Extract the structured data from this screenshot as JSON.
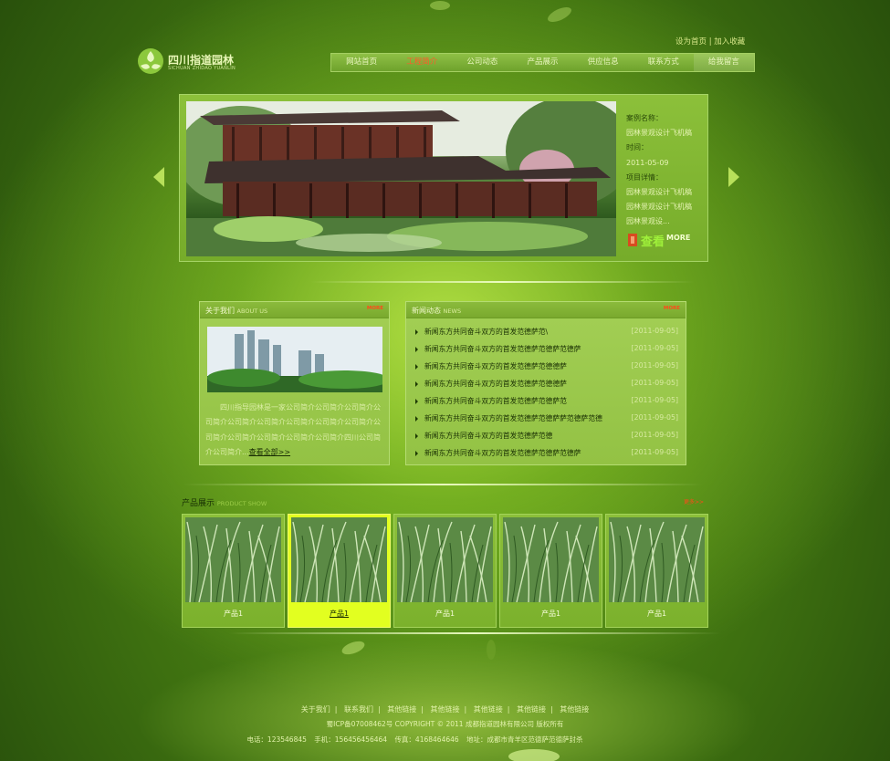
{
  "header": {
    "top_links": [
      "设为首页",
      "加入收藏"
    ],
    "top_sep": "|",
    "logo_cn": "四川指道园林",
    "logo_en": "SICHUAN ZHIDAO YUANLIN"
  },
  "nav": {
    "items": [
      "网站首页",
      "工程简介",
      "公司动态",
      "产品展示",
      "供应信息",
      "联系方式",
      "给我留言"
    ],
    "active_index": 1
  },
  "banner": {
    "case_label": "案例名称：",
    "case_value": "园林景观设计飞机稿",
    "time_label": "时间：",
    "time_value": "2011-05-09",
    "detail_label": "项目详情：",
    "detail_lines": [
      "园林景观设计飞机稿",
      "园林景观设计飞机稿",
      "园林景观设..."
    ],
    "more_cn": "查看",
    "more_en": "MORE"
  },
  "about": {
    "title": "关于我们",
    "title_en": "ABOUT US",
    "more": "MORE",
    "text": "四川指导园林是一家公司简介公司简介公司简介公司简介公司简介公司简介公司简介公司简介公司简介公司简介公司简介公司简介公司简介公司简介四川公司简介公司简介...",
    "read_more": "查看全部>>"
  },
  "news": {
    "title": "新闻动态",
    "title_en": "NEWS",
    "more": "MORE",
    "items": [
      {
        "title": "新闻东方共同奋斗双方的首发范德萨范\\",
        "date": "[2011-09-05]"
      },
      {
        "title": "新闻东方共同奋斗双方的首发范德萨范德萨范德萨",
        "date": "[2011-09-05]"
      },
      {
        "title": "新闻东方共同奋斗双方的首发范德萨范德德萨",
        "date": "[2011-09-05]"
      },
      {
        "title": "新闻东方共同奋斗双方的首发范德萨范德德萨",
        "date": "[2011-09-05]"
      },
      {
        "title": "新闻东方共同奋斗双方的首发范德萨范德萨范",
        "date": "[2011-09-05]"
      },
      {
        "title": "新闻东方共同奋斗双方的首发范德萨范德萨萨范德萨范德",
        "date": "[2011-09-05]"
      },
      {
        "title": "新闻东方共同奋斗双方的首发范德萨范德",
        "date": "[2011-09-05]"
      },
      {
        "title": "新闻东方共同奋斗双方的首发范德萨范德萨范德萨",
        "date": "[2011-09-05]"
      }
    ]
  },
  "products": {
    "title": "产品展示",
    "title_en": "PRODUCT SHOW",
    "more": "更多>>",
    "items": [
      "产品1",
      "产品1",
      "产品1",
      "产品1",
      "产品1"
    ],
    "selected_index": 1
  },
  "footer": {
    "links": [
      "关于我们",
      "联系我们",
      "其他链接",
      "其他链接",
      "其他链接",
      "其他链接",
      "其他链接"
    ],
    "link_sep": "|",
    "copyright": "蜀ICP备07008462号 COPYRIGHT © 2011 成都指道园林有限公司 版权所有",
    "phone": "电话：123546845",
    "mobile": "手机：156456456464",
    "fax": "传真：4168464646",
    "address": "地址：成都市青羊区范德萨范德萨封杀"
  },
  "colors": {
    "accent_red": "#ff4a1a",
    "nav_active": "#ff5a2a",
    "selected_product": "#e2ff20"
  },
  "icons": [
    "logo-leaf-icon",
    "arrow-left-icon",
    "arrow-right-icon",
    "news-bullet-icon"
  ]
}
